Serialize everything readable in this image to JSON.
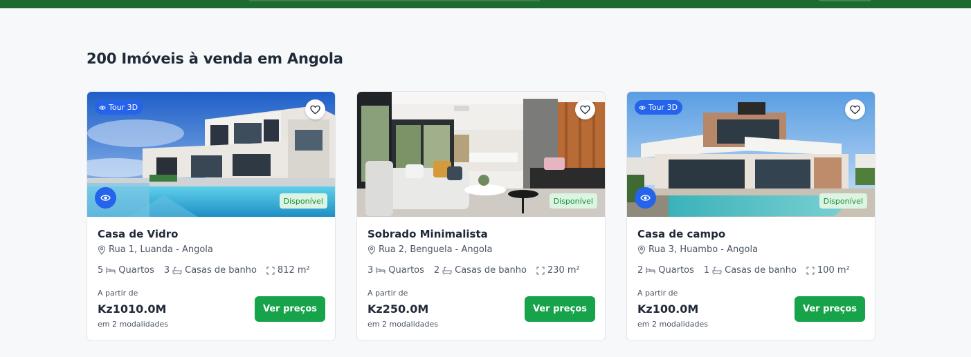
{
  "heading": "200 Imóveis à venda em Angola",
  "colors": {
    "brand": "#1e6b31",
    "accent_blue": "#2563eb",
    "button_green": "#16a34a",
    "status_bg": "#dcf5e3",
    "status_text": "#1b8a3a"
  },
  "icons": {
    "tour": "eye-icon",
    "favorite": "heart-icon",
    "view": "eye-icon",
    "location": "map-pin-icon",
    "bedrooms": "bed-icon",
    "bathrooms": "bathtub-icon",
    "area": "expand-icon"
  },
  "listings": [
    {
      "tour_label": "Tour 3D",
      "status": "Disponível",
      "title": "Casa de Vidro",
      "location": "Rua 1, Luanda - Angola",
      "bedrooms_count": "5",
      "bedrooms_label": "Quartos",
      "bathrooms_count": "3",
      "bathrooms_label": "Casas de banho",
      "area": "812 m²",
      "price_prefix": "A partir de",
      "price": "Kz1010.0M",
      "modalities": "em 2 modalidades",
      "button_label": "Ver preços"
    },
    {
      "status": "Disponível",
      "title": "Sobrado Minimalista",
      "location": "Rua 2, Benguela - Angola",
      "bedrooms_count": "3",
      "bedrooms_label": "Quartos",
      "bathrooms_count": "2",
      "bathrooms_label": "Casas de banho",
      "area": "230 m²",
      "price_prefix": "A partir de",
      "price": "Kz250.0M",
      "modalities": "em 2 modalidades",
      "button_label": "Ver preços"
    },
    {
      "tour_label": "Tour 3D",
      "status": "Disponível",
      "title": "Casa de campo",
      "location": "Rua 3, Huambo - Angola",
      "bedrooms_count": "2",
      "bedrooms_label": "Quartos",
      "bathrooms_count": "1",
      "bathrooms_label": "Casas de banho",
      "area": "100 m²",
      "price_prefix": "A partir de",
      "price": "Kz100.0M",
      "modalities": "em 2 modalidades",
      "button_label": "Ver preços"
    }
  ]
}
